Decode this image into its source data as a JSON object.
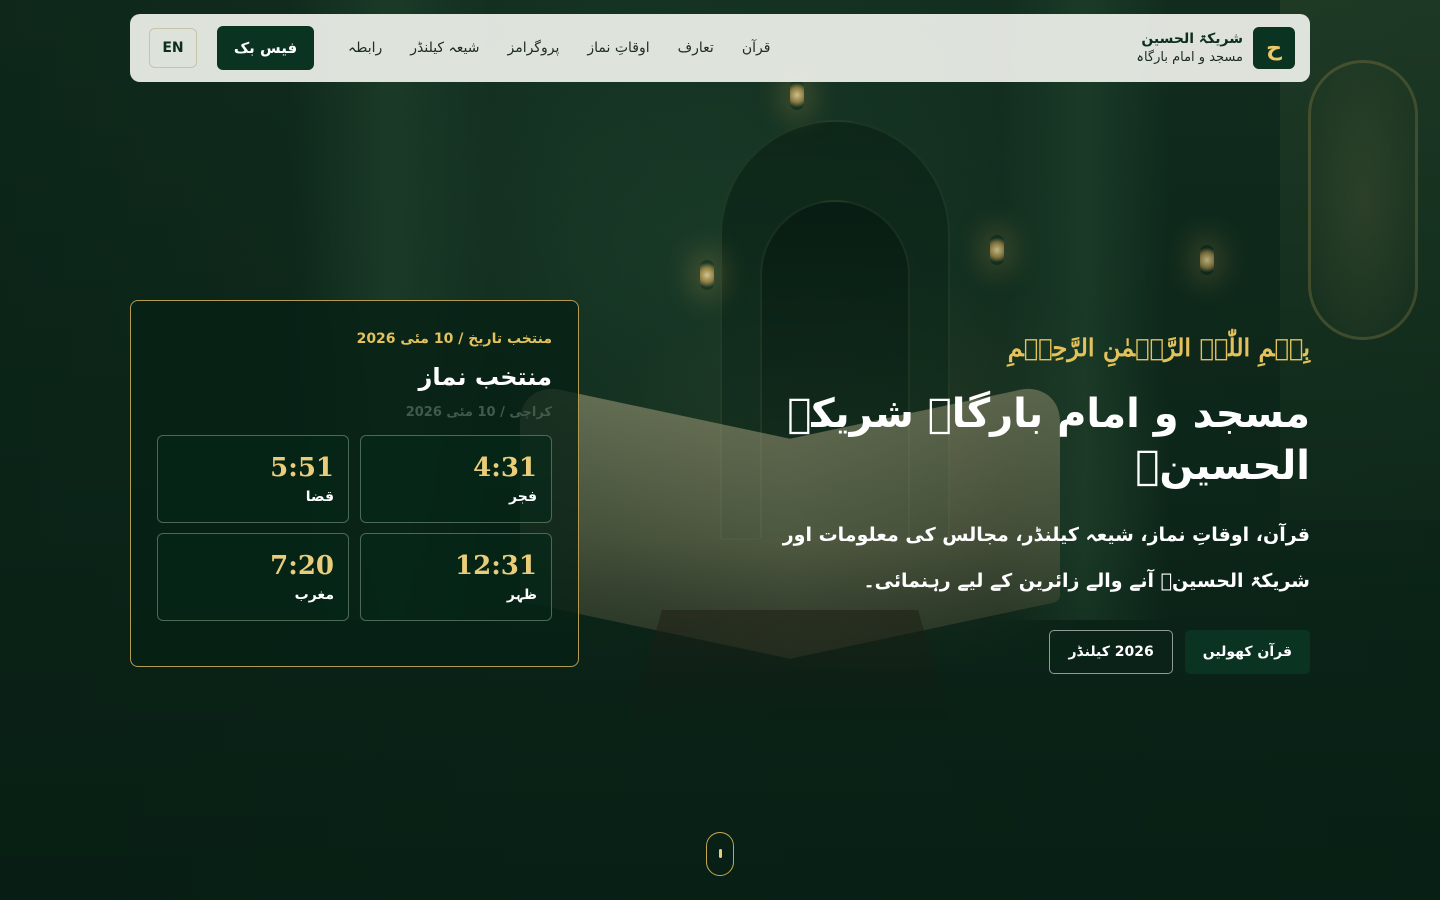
{
  "brand": {
    "logo_letter": "ح",
    "name": "شریکۃ الحسین",
    "subtitle": "مسجد و امام بارگاہ"
  },
  "nav": {
    "items": [
      "قرآن",
      "تعارف",
      "اوقاتِ نماز",
      "پروگرامز",
      "شیعہ کیلنڈر",
      "رابطہ"
    ],
    "facebook_label": "فیس بک",
    "lang_label": "EN"
  },
  "hero": {
    "bismillah": "بِسۡمِ اللّٰہِ الرَّحۡمٰنِ الرَّحِیۡمِ",
    "title": "مسجد و امام بارگاہ شریکۃ الحسینؑ",
    "description": "قرآن، اوقاتِ نماز، شیعہ کیلنڈر، مجالس کی معلومات اور شریکۃ الحسینؑ آنے والے زائرین کے لیے رہنمائی۔",
    "primary_button": "قرآن کھولیں",
    "secondary_button": "2026 کیلنڈر"
  },
  "prayer_card": {
    "date_line": "منتخب تاریخ / 10 مئی 2026",
    "title": "منتخب نماز",
    "city_line": "کراچی / 10 مئی 2026",
    "prayers": [
      {
        "name": "فجر",
        "time": "4:31"
      },
      {
        "name": "قضا",
        "time": "5:51"
      },
      {
        "name": "ظہر",
        "time": "12:31"
      },
      {
        "name": "مغرب",
        "time": "7:20"
      }
    ]
  },
  "colors": {
    "primary": "#0b3322",
    "gold": "#e3c25b",
    "header_bg": "#ebeee8"
  },
  "icons": {
    "scroll_indicator": "mouse-scroll-icon"
  }
}
